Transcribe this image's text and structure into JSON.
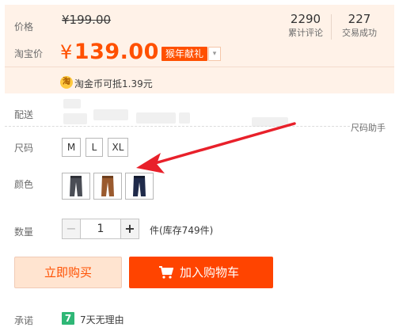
{
  "price": {
    "label": "价格",
    "original": "¥199.00",
    "promo_label": "淘宝价",
    "currency": "¥",
    "promo_value": "139.00",
    "promo_tag": "猴年献礼"
  },
  "stats": [
    {
      "num": "2290",
      "caption": "累计评论"
    },
    {
      "num": "227",
      "caption": "交易成功"
    }
  ],
  "coin": {
    "icon_char": "淘",
    "text": "淘金币可抵1.39元"
  },
  "delivery": {
    "label": "配送"
  },
  "size_helper": "尺码助手",
  "size": {
    "label": "尺码",
    "options": [
      "M",
      "L",
      "XL"
    ]
  },
  "color": {
    "label": "颜色",
    "options": [
      "dark-grey-pants",
      "brown-pants",
      "navy-pants"
    ]
  },
  "quantity": {
    "label": "数量",
    "minus": "−",
    "value": "1",
    "plus": "+",
    "stock": "件(库存749件)"
  },
  "buttons": {
    "buy_now": "立即购买",
    "add_to_cart": "加入购物车"
  },
  "promise": {
    "label": "承诺",
    "icon_char": "7",
    "text": "7天无理由"
  },
  "colors": {
    "accent": "#ff5000",
    "cart_button": "#ff4400",
    "panel_bg": "#fff2e8",
    "promise_icon": "#2fb776",
    "annotation_arrow": "#e8202a"
  }
}
